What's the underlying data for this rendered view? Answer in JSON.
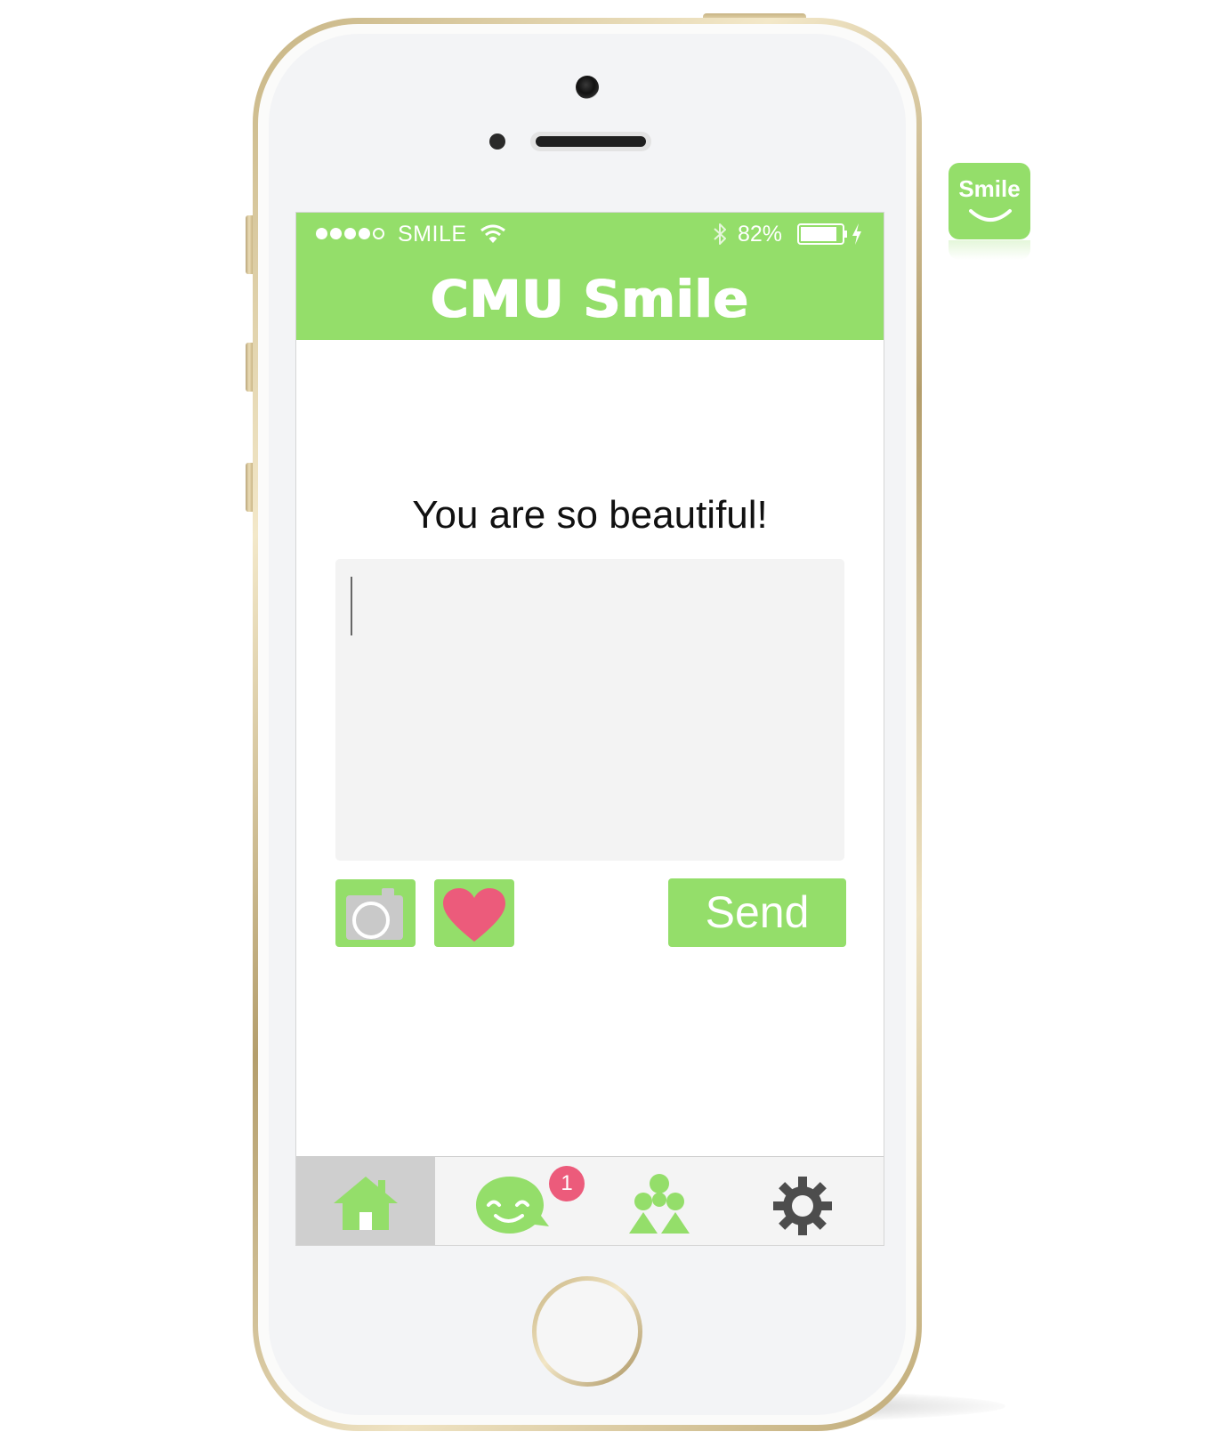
{
  "status_bar": {
    "carrier": "SMILE",
    "signal_bars_filled": 4,
    "signal_bars_total": 5,
    "battery_percent": "82%",
    "icons": [
      "wifi-icon",
      "bluetooth-icon",
      "battery-icon",
      "charging-bolt-icon"
    ]
  },
  "header": {
    "title": "CMU Smile"
  },
  "compose": {
    "prompt": "You are so beautiful!",
    "message_value": "",
    "photo_icon": "camera-icon",
    "heart_icon": "heart-icon",
    "send_label": "Send"
  },
  "tabbar": {
    "tabs": [
      {
        "name": "home",
        "icon": "home-icon",
        "selected": true
      },
      {
        "name": "smiles",
        "icon": "smile-chat-icon",
        "badge": "1"
      },
      {
        "name": "friends",
        "icon": "people-icon"
      },
      {
        "name": "settings",
        "icon": "gear-icon"
      }
    ]
  },
  "app_icon": {
    "label": "Smile"
  },
  "colors": {
    "accent": "#94de6a",
    "badge": "#ec5b7b",
    "heart": "#ec5b7b",
    "icon_gray": "#4d4d4d"
  }
}
